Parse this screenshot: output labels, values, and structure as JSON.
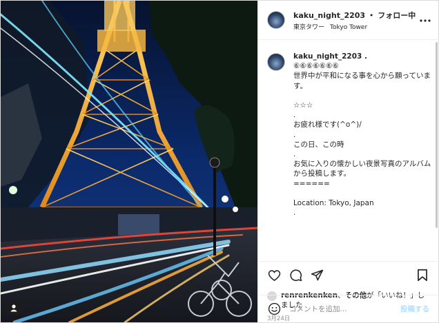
{
  "header": {
    "username": "kaku_night_2203",
    "separator": "•",
    "follow_label": "フォロー中",
    "location_ja": "東京タワー",
    "location_en": "Tokyo Tower",
    "more_icon": "more-dots-icon"
  },
  "caption": {
    "username": "kaku_night_2203 .",
    "lines": [
      "⑥⑥⑥⑥⑥⑥⑥",
      "世界中が平和になる事を心から願っています。",
      "",
      "☆☆☆",
      ".",
      "お疲れ様です(^o^)/",
      ".",
      "この日、この時",
      ".",
      "お気に入りの懐かしい夜景写真のアルバムから投稿します。",
      "======",
      "",
      "Location: Tokyo, Japan",
      "."
    ]
  },
  "actions": {
    "icons": [
      "heart-icon",
      "comment-icon",
      "share-icon",
      "bookmark-icon"
    ]
  },
  "likes": {
    "user": "renrenkenken",
    "middle": "、",
    "others": "その他",
    "suffix": "が「いいね！」しました"
  },
  "date": "3月24日",
  "comment_box": {
    "placeholder": "コメントを追加...",
    "post_label": "投稿する"
  },
  "colors": {
    "post_disabled": "#b2dffc",
    "text": "#262626",
    "muted": "#8e8e8e",
    "border": "#dbdbdb"
  }
}
